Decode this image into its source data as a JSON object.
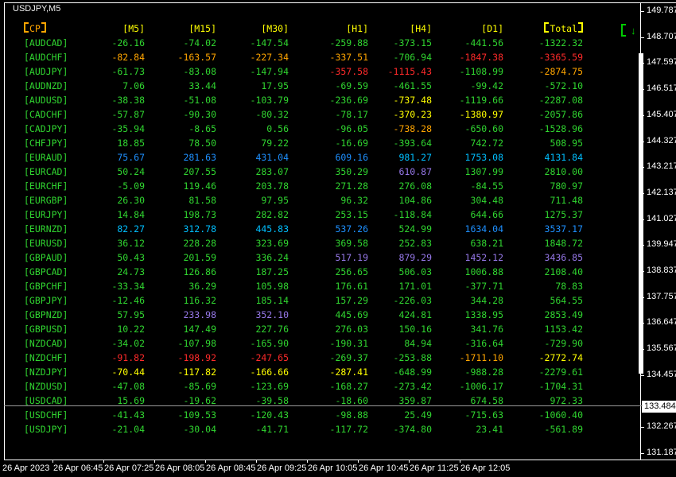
{
  "window": {
    "title": "USDJPY,M5"
  },
  "icon": {
    "arrow": "↓"
  },
  "colors": {
    "g": "#30D530",
    "o": "#FFA500",
    "r": "#FF2A2A",
    "y": "#FFFF00",
    "b": "#1E90FF",
    "c": "#00BFFF",
    "p": "#9678E8",
    "header": "#FFFF00",
    "cp": "#FFA500",
    "pair": "#30D530",
    "icon": "#00CC00",
    "axis_text": "#FFFFFF"
  },
  "table": {
    "headers": [
      {
        "text": "CP",
        "full_bracket": true,
        "color": "cp"
      },
      {
        "text": "[M5]",
        "color": "header"
      },
      {
        "text": "[M15]",
        "color": "header"
      },
      {
        "text": "[M30]",
        "color": "header"
      },
      {
        "text": "[H1]",
        "color": "header"
      },
      {
        "text": "[H4]",
        "color": "header"
      },
      {
        "text": "[D1]",
        "color": "header"
      },
      {
        "text": "Total",
        "full_bracket": true,
        "color": "header"
      }
    ],
    "rows": [
      {
        "pair": "[AUDCAD]",
        "values": [
          "-26.16",
          "-74.02",
          "-147.54",
          "-259.88",
          "-373.15",
          "-441.56",
          "-1322.32"
        ],
        "colors": [
          "g",
          "g",
          "g",
          "g",
          "g",
          "g",
          "g"
        ]
      },
      {
        "pair": "[AUDCHF]",
        "values": [
          "-82.84",
          "-163.57",
          "-227.34",
          "-337.51",
          "-706.94",
          "-1847.38",
          "-3365.59"
        ],
        "colors": [
          "o",
          "o",
          "o",
          "o",
          "g",
          "r",
          "r"
        ]
      },
      {
        "pair": "[AUDJPY]",
        "values": [
          "-61.73",
          "-83.08",
          "-147.94",
          "-357.58",
          "-1115.43",
          "-1108.99",
          "-2874.75"
        ],
        "colors": [
          "g",
          "g",
          "g",
          "r",
          "r",
          "g",
          "o"
        ]
      },
      {
        "pair": "[AUDNZD]",
        "values": [
          "7.06",
          "33.44",
          "17.95",
          "-69.59",
          "-461.55",
          "-99.42",
          "-572.10"
        ],
        "colors": [
          "g",
          "g",
          "g",
          "g",
          "g",
          "g",
          "g"
        ]
      },
      {
        "pair": "[AUDUSD]",
        "values": [
          "-38.38",
          "-51.08",
          "-103.79",
          "-236.69",
          "-737.48",
          "-1119.66",
          "-2287.08"
        ],
        "colors": [
          "g",
          "g",
          "g",
          "g",
          "y",
          "g",
          "g"
        ]
      },
      {
        "pair": "[CADCHF]",
        "values": [
          "-57.87",
          "-90.30",
          "-80.32",
          "-78.17",
          "-370.23",
          "-1380.97",
          "-2057.86"
        ],
        "colors": [
          "g",
          "g",
          "g",
          "g",
          "y",
          "y",
          "g"
        ]
      },
      {
        "pair": "[CADJPY]",
        "values": [
          "-35.94",
          "-8.65",
          "0.56",
          "-96.05",
          "-738.28",
          "-650.60",
          "-1528.96"
        ],
        "colors": [
          "g",
          "g",
          "g",
          "g",
          "o",
          "g",
          "g"
        ]
      },
      {
        "pair": "[CHFJPY]",
        "values": [
          "18.85",
          "78.50",
          "79.22",
          "-16.69",
          "-393.64",
          "742.72",
          "508.95"
        ],
        "colors": [
          "g",
          "g",
          "g",
          "g",
          "g",
          "g",
          "g"
        ]
      },
      {
        "pair": "[EURAUD]",
        "values": [
          "75.67",
          "281.63",
          "431.04",
          "609.16",
          "981.27",
          "1753.08",
          "4131.84"
        ],
        "colors": [
          "b",
          "b",
          "b",
          "b",
          "c",
          "c",
          "c"
        ]
      },
      {
        "pair": "[EURCAD]",
        "values": [
          "50.24",
          "207.55",
          "283.07",
          "350.29",
          "610.87",
          "1307.99",
          "2810.00"
        ],
        "colors": [
          "g",
          "g",
          "g",
          "g",
          "p",
          "g",
          "g"
        ]
      },
      {
        "pair": "[EURCHF]",
        "values": [
          "-5.09",
          "119.46",
          "203.78",
          "271.28",
          "276.08",
          "-84.55",
          "780.97"
        ],
        "colors": [
          "g",
          "g",
          "g",
          "g",
          "g",
          "g",
          "g"
        ]
      },
      {
        "pair": "[EURGBP]",
        "values": [
          "26.30",
          "81.58",
          "97.95",
          "96.32",
          "104.86",
          "304.48",
          "711.48"
        ],
        "colors": [
          "g",
          "g",
          "g",
          "g",
          "g",
          "g",
          "g"
        ]
      },
      {
        "pair": "[EURJPY]",
        "values": [
          "14.84",
          "198.73",
          "282.82",
          "253.15",
          "-118.84",
          "644.66",
          "1275.37"
        ],
        "colors": [
          "g",
          "g",
          "g",
          "g",
          "g",
          "g",
          "g"
        ]
      },
      {
        "pair": "[EURNZD]",
        "values": [
          "82.27",
          "312.78",
          "445.83",
          "537.26",
          "524.99",
          "1634.04",
          "3537.17"
        ],
        "colors": [
          "c",
          "c",
          "c",
          "b",
          "g",
          "b",
          "b"
        ]
      },
      {
        "pair": "[EURUSD]",
        "values": [
          "36.12",
          "228.28",
          "323.69",
          "369.58",
          "252.83",
          "638.21",
          "1848.72"
        ],
        "colors": [
          "g",
          "g",
          "g",
          "g",
          "g",
          "g",
          "g"
        ]
      },
      {
        "pair": "[GBPAUD]",
        "values": [
          "50.43",
          "201.59",
          "336.24",
          "517.19",
          "879.29",
          "1452.12",
          "3436.85"
        ],
        "colors": [
          "g",
          "g",
          "g",
          "p",
          "p",
          "p",
          "p"
        ]
      },
      {
        "pair": "[GBPCAD]",
        "values": [
          "24.73",
          "126.86",
          "187.25",
          "256.65",
          "506.03",
          "1006.88",
          "2108.40"
        ],
        "colors": [
          "g",
          "g",
          "g",
          "g",
          "g",
          "g",
          "g"
        ]
      },
      {
        "pair": "[GBPCHF]",
        "values": [
          "-33.34",
          "36.29",
          "105.98",
          "176.61",
          "171.01",
          "-377.71",
          "78.83"
        ],
        "colors": [
          "g",
          "g",
          "g",
          "g",
          "g",
          "g",
          "g"
        ]
      },
      {
        "pair": "[GBPJPY]",
        "values": [
          "-12.46",
          "116.32",
          "185.14",
          "157.29",
          "-226.03",
          "344.28",
          "564.55"
        ],
        "colors": [
          "g",
          "g",
          "g",
          "g",
          "g",
          "g",
          "g"
        ]
      },
      {
        "pair": "[GBPNZD]",
        "values": [
          "57.95",
          "233.98",
          "352.10",
          "445.69",
          "424.81",
          "1338.95",
          "2853.49"
        ],
        "colors": [
          "g",
          "p",
          "p",
          "g",
          "g",
          "g",
          "g"
        ]
      },
      {
        "pair": "[GBPUSD]",
        "values": [
          "10.22",
          "147.49",
          "227.76",
          "276.03",
          "150.16",
          "341.76",
          "1153.42"
        ],
        "colors": [
          "g",
          "g",
          "g",
          "g",
          "g",
          "g",
          "g"
        ]
      },
      {
        "pair": "[NZDCAD]",
        "values": [
          "-34.02",
          "-107.98",
          "-165.90",
          "-190.31",
          "84.94",
          "-316.64",
          "-729.90"
        ],
        "colors": [
          "g",
          "g",
          "g",
          "g",
          "g",
          "g",
          "g"
        ]
      },
      {
        "pair": "[NZDCHF]",
        "values": [
          "-91.82",
          "-198.92",
          "-247.65",
          "-269.37",
          "-253.88",
          "-1711.10",
          "-2772.74"
        ],
        "colors": [
          "r",
          "r",
          "r",
          "g",
          "g",
          "o",
          "y"
        ]
      },
      {
        "pair": "[NZDJPY]",
        "values": [
          "-70.44",
          "-117.82",
          "-166.66",
          "-287.41",
          "-648.99",
          "-988.28",
          "-2279.61"
        ],
        "colors": [
          "y",
          "y",
          "y",
          "y",
          "g",
          "g",
          "g"
        ]
      },
      {
        "pair": "[NZDUSD]",
        "values": [
          "-47.08",
          "-85.69",
          "-123.69",
          "-168.27",
          "-273.42",
          "-1006.17",
          "-1704.31"
        ],
        "colors": [
          "g",
          "g",
          "g",
          "g",
          "g",
          "g",
          "g"
        ]
      },
      {
        "pair": "[USDCAD]",
        "values": [
          "15.69",
          "-19.62",
          "-39.58",
          "-18.60",
          "359.87",
          "674.58",
          "972.33"
        ],
        "colors": [
          "g",
          "g",
          "g",
          "g",
          "g",
          "g",
          "g"
        ]
      },
      {
        "pair": "[USDCHF]",
        "values": [
          "-41.43",
          "-109.53",
          "-120.43",
          "-98.88",
          "25.49",
          "-715.63",
          "-1060.40"
        ],
        "colors": [
          "g",
          "g",
          "g",
          "g",
          "g",
          "g",
          "g"
        ]
      },
      {
        "pair": "[USDJPY]",
        "values": [
          "-21.04",
          "-30.04",
          "-41.71",
          "-117.72",
          "-374.80",
          "23.41",
          "-561.89"
        ],
        "colors": [
          "g",
          "g",
          "g",
          "g",
          "g",
          "g",
          "g"
        ]
      }
    ]
  },
  "price_axis": {
    "labels": [
      "149.787",
      "148.707",
      "147.597",
      "146.517",
      "145.407",
      "144.327",
      "143.217",
      "142.137",
      "141.027",
      "139.947",
      "138.837",
      "137.757",
      "136.647",
      "135.567",
      "134.457",
      "132.267",
      "131.187"
    ],
    "current": "133.484"
  },
  "time_axis": {
    "labels": [
      "26 Apr 2023",
      "26 Apr 06:45",
      "26 Apr 07:25",
      "26 Apr 08:05",
      "26 Apr 08:45",
      "26 Apr 09:25",
      "26 Apr 10:05",
      "26 Apr 10:45",
      "26 Apr 11:25",
      "26 Apr 12:05"
    ]
  }
}
